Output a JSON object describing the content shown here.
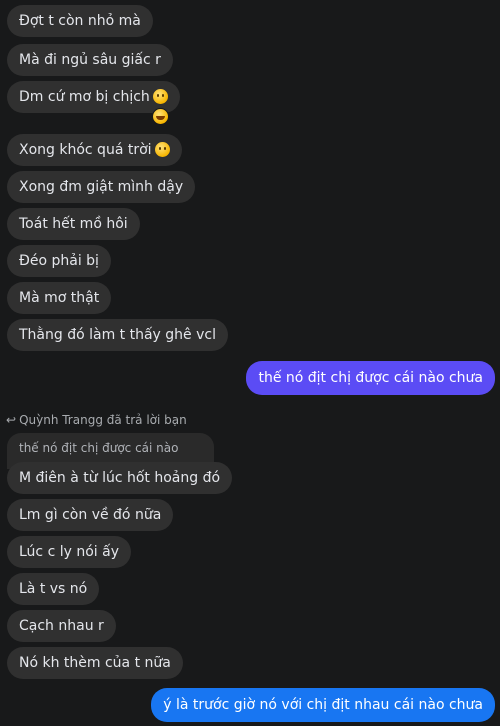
{
  "incoming_top": [
    {
      "text": "Đợt t còn nhỏ mà"
    },
    {
      "text": "Mà đi ngủ sâu giấc r"
    },
    {
      "text": "Dm cứ mơ bị chịch",
      "emoji": "slightly-smiling-emoji",
      "reaction": "grinning-sweat-reaction"
    },
    {
      "text": "Xong khóc quá trời",
      "emoji": "slightly-smiling-emoji"
    },
    {
      "text": "Xong đm giật mình dậy"
    },
    {
      "text": "Toát hết mồ hôi"
    },
    {
      "text": "Đéo phải bị"
    },
    {
      "text": "Mà mơ thật"
    },
    {
      "text": "Thằng đó làm t thấy ghê vcl"
    }
  ],
  "outgoing_1": {
    "text": "thế nó địt chị được cái nào chưa",
    "color": "#5b4cf5"
  },
  "reply": {
    "label": "Quỳnh Trangg đã trả lời bạn",
    "icon": "reply-arrow-icon",
    "quoted": "thế nó địt chị được cái nào chưa"
  },
  "incoming_bottom": [
    {
      "text": "M điên à từ lúc hốt hoảng đó"
    },
    {
      "text": "Lm gì còn về đó nữa"
    },
    {
      "text": "Lúc c ly nói ấy"
    },
    {
      "text": "Là t vs nó"
    },
    {
      "text": "Cạch nhau r"
    },
    {
      "text": "Nó kh thèm của t nữa"
    }
  ],
  "outgoing_2": {
    "text": "ý là trước giờ nó với chị địt nhau cái nào chưa",
    "color": "#1876f2"
  }
}
